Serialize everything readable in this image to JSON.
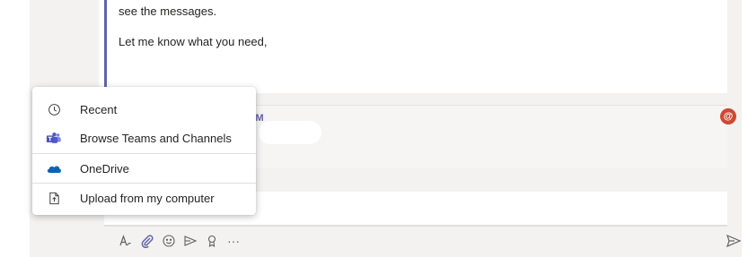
{
  "message": {
    "lines": [
      "see the messages.",
      "Let me know what you need,"
    ]
  },
  "reply": {
    "time_fragment": "5 PM",
    "mark": "!"
  },
  "mention_badge": {
    "label": "@",
    "color": "#cc4a31"
  },
  "attach_menu": {
    "items": [
      {
        "label": "Recent",
        "icon": "clock-icon"
      },
      {
        "label": "Browse Teams and Channels",
        "icon": "teams-icon"
      },
      {
        "label": "OneDrive",
        "icon": "onedrive-icon"
      },
      {
        "label": "Upload from my computer",
        "icon": "upload-icon"
      }
    ]
  },
  "toolbar": {
    "icons": [
      "format-icon",
      "attach-icon",
      "emoji-icon",
      "gif-icon",
      "praise-icon",
      "more-icon"
    ],
    "more_label": "···"
  },
  "colors": {
    "accent": "#6264a7",
    "onedrive": "#0364b8",
    "alert": "#c4314b"
  }
}
